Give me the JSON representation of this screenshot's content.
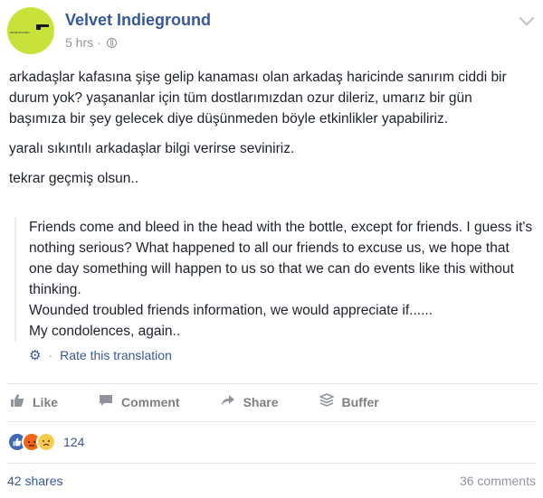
{
  "page": {
    "name": "Velvet Indieground",
    "time": "5 hrs",
    "separator": "·",
    "avatar_text": "INDIEGROUND"
  },
  "post": {
    "paragraphs": [
      "arkadaşlar kafasına şişe gelip kanaması olan arkadaş haricinde sanırım ciddi bir durum yok? yaşananlar için tüm dostlarımızdan ozur dileriz, umarız bir gün başımıza bir şey gelecek diye düşünmeden böyle etkinlikler yapabiliriz.",
      "yaralı sıkıntılı arkadaşlar bilgi verirse seviniriz.",
      "tekrar geçmiş olsun.."
    ]
  },
  "translation": {
    "lines": [
      "Friends come and bleed in the head with the bottle, except for friends. I guess it's nothing serious? What happened to all our friends to excuse us, we hope that one day something will happen to us so that we can do events like this without thinking.",
      "Wounded troubled friends information, we would appreciate if......",
      "My condolences, again.."
    ],
    "rate_label": "Rate this translation",
    "rate_icon": "gear-icon"
  },
  "actions": [
    {
      "label": "Like",
      "icon": "thumbs-up-icon"
    },
    {
      "label": "Comment",
      "icon": "comment-icon"
    },
    {
      "label": "Share",
      "icon": "share-icon"
    },
    {
      "label": "Buffer",
      "icon": "buffer-icon"
    }
  ],
  "reactions": {
    "count": "124",
    "types": [
      "like",
      "angry",
      "sad"
    ]
  },
  "footer": {
    "shares": "42 shares",
    "comments": "36 comments"
  },
  "colors": {
    "link": "#365899",
    "muted": "#90949c",
    "avatar": "#c9e23a"
  }
}
